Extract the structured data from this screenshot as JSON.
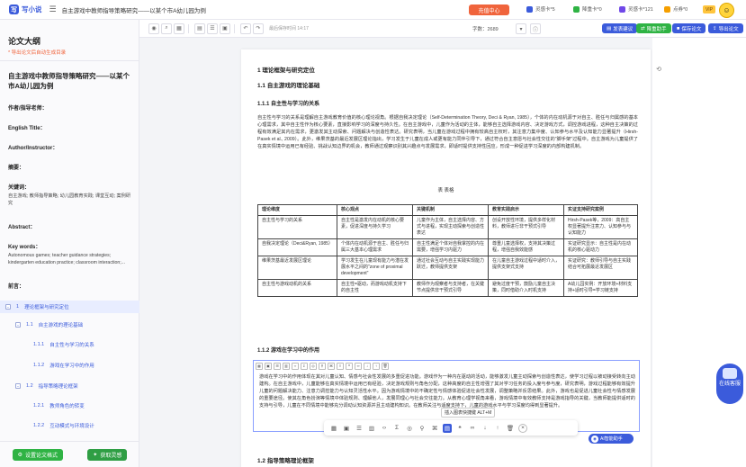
{
  "app": {
    "logo_text": "写小说",
    "doc_title": "自主游戏中教师指导策略研究——以某个市A幼儿园为例"
  },
  "topbar": {
    "recharge": "充值中心",
    "stats": [
      {
        "label": "灵感卡*5",
        "color": "#3b5bdb"
      },
      {
        "label": "降重卡*0",
        "color": "#2fb344"
      },
      {
        "label": "灵感卡*121",
        "color": "#7048e8"
      },
      {
        "label": "点券*0",
        "color": "#f59f00"
      }
    ],
    "vip": "VIP"
  },
  "left_panel": {
    "title": "论文大纲",
    "hint": "* 导出论文后自动生成目录",
    "paper_title": "自主游戏中教师指导策略研究——以某个市A幼儿园为例",
    "fields": [
      {
        "label": "作者/指导老师：",
        "value": ""
      },
      {
        "label": "English Title：",
        "value": ""
      },
      {
        "label": "Author/Instructor：",
        "value": ""
      },
      {
        "label": "摘要：",
        "value": ""
      },
      {
        "label": "关键词：",
        "value": "自主游戏; 教师指导策略; 幼儿园教育实践; 课堂互动; 案例研究"
      },
      {
        "label": "Abstract：",
        "value": ""
      },
      {
        "label": "Key words：",
        "value": "Autonomous games; teacher guidance strategies; kindergarten education practice; classroom interaction;..."
      },
      {
        "label": "前言：",
        "value": ""
      }
    ],
    "outline": [
      {
        "num": "1",
        "label": "理论框架与研究定位",
        "level": 0,
        "active": true
      },
      {
        "num": "1.1",
        "label": "自主游戏的理论基础",
        "level": 1
      },
      {
        "num": "1.1.1",
        "label": "自主性与学习的关系",
        "level": 2
      },
      {
        "num": "1.1.2",
        "label": "游戏在学习中的作用",
        "level": 2
      },
      {
        "num": "1.2",
        "label": "指导策略理论框架",
        "level": 1
      },
      {
        "num": "1.2.1",
        "label": "教师角色的转变",
        "level": 2
      },
      {
        "num": "1.2.2",
        "label": "互动模式与环境设计",
        "level": 2
      }
    ],
    "buttons": {
      "settings": "设置论文格式",
      "inspire": "获取灵感"
    }
  },
  "toolbar": {
    "autosave": "最后保存时间 14:17",
    "wordcount": "字数：2689",
    "pills": [
      {
        "label": "发表建议",
        "color": "#3b5bdb"
      },
      {
        "label": "降重助手",
        "color": "#2fb344"
      },
      {
        "label": "保存论文",
        "color": "#3b5bdb"
      },
      {
        "label": "导出论文",
        "color": "#3b5bdb"
      }
    ]
  },
  "document": {
    "h1": "1 理论框架与研究定位",
    "h2_1": "1.1 自主游戏的理论基础",
    "h3_1": "1.1.1 自主性与学习的关系",
    "para1": "自主性与学习的关系是理解自主游戏教育价值的核心理论视角。根据自我决定理论（Self-Determination Theory, Deci & Ryan, 1985），个体的内在动机源于对自主、胜任与归属感的基本心理需求，其中自主性作为核心要素，直接影响学习的深度与持久性。在自主游戏中，儿童作为活动的主体，能够自主选择游戏内容、决定游戏方式，调控游戏进程，这种自主决策的过程有效满足其内在需求，更激发其主动探索、问题解决与创造性表达。研究表明，当儿童在游戏过程中拥有较高自主权时，其注意力集中度、认知参与水平及认知能力显著提升（Hirsh-Pasek et al., 2009）。此外，维果茨基的最近发展区理论指出，学习发生于儿童在成人或更有能力同伴引导下，通过符合自主意愿与社会性交往的\"脚手架\"过程中。自主游戏为儿童提供了在真实情境中运用已有经验、挑战认知边界的机会，教师通过观察识别其兴趣点与发展需求，即适时提供支持性回应，形成一种促进学习深度的内部构建机制。",
    "table_caption": "表  表格",
    "table_headers": [
      "理论维度",
      "核心观点",
      "关键机制",
      "教育实践启示",
      "实证支持研究案例"
    ],
    "table_rows": [
      [
        "自主性与学习的关系",
        "自主性是激发内在动机的核心要素，促进深度与持久学习",
        "儿童作为主体，自主选择内容、方式与进程，实现主动探索与创造性表达",
        "创设开放性环境，提供多样化材料，教师进行非干预式引导",
        "Hirsh-Pasek等，2009：高自主权显著提升注意力、认知参与与认知能力"
      ],
      [
        "自我决定理论（Deci&Ryan, 1985）",
        "个体内在动机源于自主、胜任与归属三大基本心理需求",
        "自主性满足个体对自我掌控的内在需要，增强学习内驱力",
        "尊重儿童选择权，支持其决策过程，增强自我效能感",
        "实证研究显示：自主性是内在动机的核心驱动力"
      ],
      [
        "维果茨基最近发展区理论",
        "学习发生在儿童现有能力与潜在发展水平之间的\"zone of proximal development\"",
        "通过社会互动与自主实践实现能力跃迁，教师提供支架",
        "在儿童自主游戏过程中适时介入，提供支架式支持",
        "实证研究：教师引导与自主实践结合可拓展最近发展区"
      ],
      [
        "自主性与游戏动机的关系",
        "自主性=驱动，而游戏动机支持下的自主性",
        "教师作为观察者与支持者，在关键节点提供非干预式引导",
        "避免过度干预，鼓励儿童自主决策，同时借助介入时机支持",
        "A幼儿园实例：开放环境+材料支持+适时引导=学习链支持"
      ]
    ],
    "h3_2": "1.1.2 游戏在学习中的作用",
    "para2": "游戏在学习中的作用体现在其对儿童认知、情感与社会性发展的多重促进功能。游戏作为一种内在驱动的活动，能够激发儿童主动探索与创造性表达，使学习过程以被动接受转向主动建构。在自主游戏中，儿童能够在真实情境中运用已有经验，决定游戏规则与角色分配，这种高度的自主性增强了其对学习任务的投入度与参与度，研究表明，游戏过程能够有效提升儿童的问题解决能力、注意力调控能力与认知灵活性水平。因为游戏情境中的不确定性与情感体验促进社会性发展，调整策略并反思结果。此外，游戏也是促进儿童社会性与情感发展的重要途径。使其在角色扮演等情境中体验规则、理解他人，发展同理心与社会交往能力。从教育心理学视角来看，游戏情境中有效教师支持是游戏指导的关键，当教师能提供适时的支持与引导，儿童在不同情境中能够充分调动认知资源并且主动建构知识。在教师关注与适度支持下，儿童的游戏水平与学习深度均得到显著提升。",
    "h2_2": "1.2 指导策略理论框架",
    "tooltip": "插入图表快捷键 ALT+M",
    "ai_chip": "AI智能助手"
  },
  "rail": {
    "help": "在线客服"
  }
}
